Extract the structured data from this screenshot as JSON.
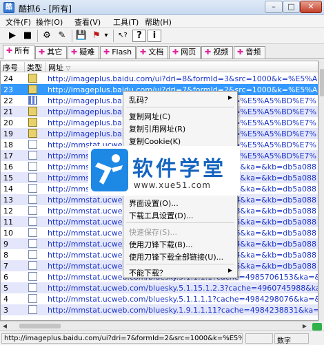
{
  "window": {
    "title": "酷抓6 - [所有]",
    "app_icon": "酷",
    "minimize_glyph": "–",
    "maximize_glyph": "□",
    "close_glyph": "✕"
  },
  "menu": [
    "文件(F)",
    "操作(O)",
    "查看(V)",
    "工具(T)",
    "帮助(H)"
  ],
  "toolbar": {
    "icons": [
      "play-icon",
      "stop-icon",
      "network-icon",
      "highlighter-icon",
      "save-icon",
      "flag-icon",
      "dropdown-icon",
      "cursor-help-icon",
      "help-icon",
      "info-icon"
    ],
    "glyphs": [
      "▶",
      "■",
      "⚙",
      "✎",
      "💾",
      "⚑",
      "▾",
      "↖?",
      "?",
      "i"
    ]
  },
  "tabs": [
    {
      "label": "所有",
      "icon": "✚"
    },
    {
      "label": "其它",
      "icon": "✚"
    },
    {
      "label": "疑难",
      "icon": "✚"
    },
    {
      "label": "Flash",
      "icon": "✚"
    },
    {
      "label": "文档",
      "icon": "✚"
    },
    {
      "label": "网页",
      "icon": "✚"
    },
    {
      "label": "视频",
      "icon": "✚"
    },
    {
      "label": "音频",
      "icon": "✚"
    }
  ],
  "columns": {
    "no": "序号",
    "type": "类型",
    "url": "网址",
    "sort_glyph": "▽"
  },
  "rows": [
    {
      "no": "24",
      "type": "img",
      "url": "http://imageplus.baidu.com/ui?dri=8&formId=3&src=1000&k=%E5%A5%BD%E7%"
    },
    {
      "no": "23",
      "type": "img",
      "url": "http://imageplus.baidu.com/ui?dri=7&formId=2&src=1000&k=%E5%A5%BD%E7%"
    },
    {
      "no": "22",
      "type": "grid",
      "url": "http://imageplus.ba"
    },
    {
      "no": "21",
      "type": "img",
      "url": "http://imageplus.ba"
    },
    {
      "no": "20",
      "type": "img",
      "url": "http://imageplus.ba"
    },
    {
      "no": "19",
      "type": "img",
      "url": "http://imageplus.ba"
    },
    {
      "no": "18",
      "type": "doc",
      "url": "http://mmstat.ucweb"
    },
    {
      "no": "17",
      "type": "doc",
      "url": "http://mmstat.ucweb"
    },
    {
      "no": "16",
      "type": "doc",
      "url": "http://mmstat.ucweb"
    },
    {
      "no": "15",
      "type": "doc",
      "url": "http://mmstat.ucweb"
    },
    {
      "no": "14",
      "type": "doc",
      "url": "http://mmstat.ucweb"
    },
    {
      "no": "13",
      "type": "doc",
      "url": "http://mmstat.ucweb"
    },
    {
      "no": "12",
      "type": "doc",
      "url": "http://mmstat.ucweb"
    },
    {
      "no": "11",
      "type": "doc",
      "url": "http://mmstat.ucweb"
    },
    {
      "no": "10",
      "type": "doc",
      "url": "http://mmstat.ucweb"
    },
    {
      "no": "9",
      "type": "doc",
      "url": "http://mmstat.ucweb"
    },
    {
      "no": "8",
      "type": "doc",
      "url": "http://mmstat.ucweb"
    },
    {
      "no": "7",
      "type": "doc",
      "url": "http://mmstat.ucweb"
    },
    {
      "no": "6",
      "type": "doc",
      "url": "http://mmstat.ucweb.com/bluesky.5.1.1.1.1?cache=4985706153&ka=&kb=db5a088"
    },
    {
      "no": "5",
      "type": "doc",
      "url": "http://mmstat.ucweb.com/bluesky.5.1.15.1.2.3?cache=4960745988&ka=&kb=db5a088"
    },
    {
      "no": "4",
      "type": "doc",
      "url": "http://mmstat.ucweb.com/bluesky.5.1.1.1.1?cache=4984298076&ka=&kb=db5a088"
    },
    {
      "no": "3",
      "type": "doc",
      "url": "http://mmstat.ucweb.com/bluesky.1.9.1.1.11?cache=4984238831&ka=&kb=db5a088"
    }
  ],
  "right_fragments": [
    "k=%E5%A5%BD%E7%",
    "k=%E5%A5%BD%E7%",
    "k=%E5%A5%BD%E7%",
    "k=%E5%A5%BD%E7%",
    "k=%E5%A5%BD%E7%",
    "k=%E5%A5%BD%E7%",
    "&ka=&kb=db5a088",
    "53&ka=&kb=db5a088",
    "53&ka=&kb=db5a088",
    "844&ka=&kb=db5a088",
    "3&ka=&kb=db5a088",
    "195&ka=&kb=db5a088",
    "656&ka=&kb=db5a088",
    "614&ka=&kb=db5a088",
    "084&ka=&kb=db5a088",
    "715&ka=&kb=db5a088"
  ],
  "context_menu": {
    "items": [
      {
        "label": "乱码？",
        "submenu": true,
        "disabled": false
      },
      {
        "label": "复制网址(C)",
        "submenu": false,
        "disabled": false
      },
      {
        "label": "复制引用网址(R)",
        "submenu": false,
        "disabled": false
      },
      {
        "label": "复制Cookie(K)",
        "submenu": false,
        "disabled": false
      },
      {
        "label": "界面设置(O)...",
        "submenu": false,
        "disabled": false
      },
      {
        "label": "下载工具设置(D)...",
        "submenu": false,
        "disabled": false
      },
      {
        "label": "快速保存(S)...",
        "submenu": false,
        "disabled": true
      },
      {
        "label": "使用刀锋下载(B)...",
        "submenu": false,
        "disabled": false
      },
      {
        "label": "使用刀锋下载全部链接(U)...",
        "submenu": false,
        "disabled": false
      },
      {
        "label": "不能下载？",
        "submenu": true,
        "disabled": false
      }
    ],
    "submenu_glyph": "▶"
  },
  "watermark": {
    "title": "软件学堂",
    "site": "www.xue51.com"
  },
  "status": {
    "url": "http://imageplus.baidu.com/ui?dri=7&formId=2&src=1000&k=%E5%A5%BD%E",
    "field2": "",
    "mode": "数字"
  },
  "scroll": {
    "left_glyph": "◀",
    "right_glyph": "▶"
  }
}
